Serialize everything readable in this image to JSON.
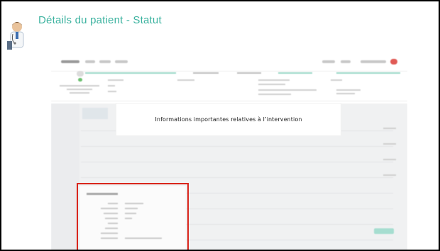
{
  "slide": {
    "title": "Détails du patient - Statut"
  },
  "overlay": {
    "caption": "Informations importantes relatives à l’intervention"
  },
  "colors": {
    "title": "#3db3a0",
    "highlight_border": "#d9261c",
    "accent": "#9cd8c8"
  },
  "icons": {
    "presenter": "doctor-icon"
  }
}
